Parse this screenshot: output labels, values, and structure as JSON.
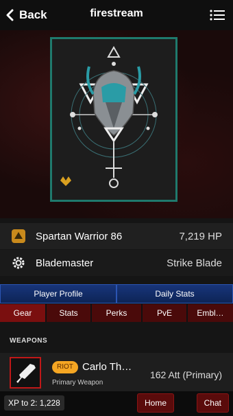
{
  "header": {
    "back_label": "Back",
    "title": "firestream"
  },
  "hero": {
    "frame_color": "#1f7a6d"
  },
  "guardian": {
    "name": "Spartan Warrior 86",
    "hp": "7,219 HP",
    "subclass": "Blademaster",
    "super": "Strike Blade"
  },
  "tabs_primary": [
    "Player Profile",
    "Daily Stats"
  ],
  "tabs_secondary": [
    "Gear",
    "Stats",
    "Perks",
    "PvE",
    "Embl…"
  ],
  "tabs_secondary_active": "Gear",
  "weapons": {
    "section_label": "WEAPONS",
    "items": [
      {
        "badge": "RIOT",
        "name": "Carlo Th…",
        "type": "Primary Weapon",
        "stat": "162 Att (Primary)"
      }
    ]
  },
  "footer": {
    "xp_label": "XP to 2: 1,228",
    "home_label": "Home",
    "chat_label": "Chat"
  },
  "colors": {
    "accent_teal": "#1f7a6d",
    "tab_blue": "#0d2456",
    "tab_red": "#7a0f0f",
    "badge_orange": "#f5a623"
  }
}
